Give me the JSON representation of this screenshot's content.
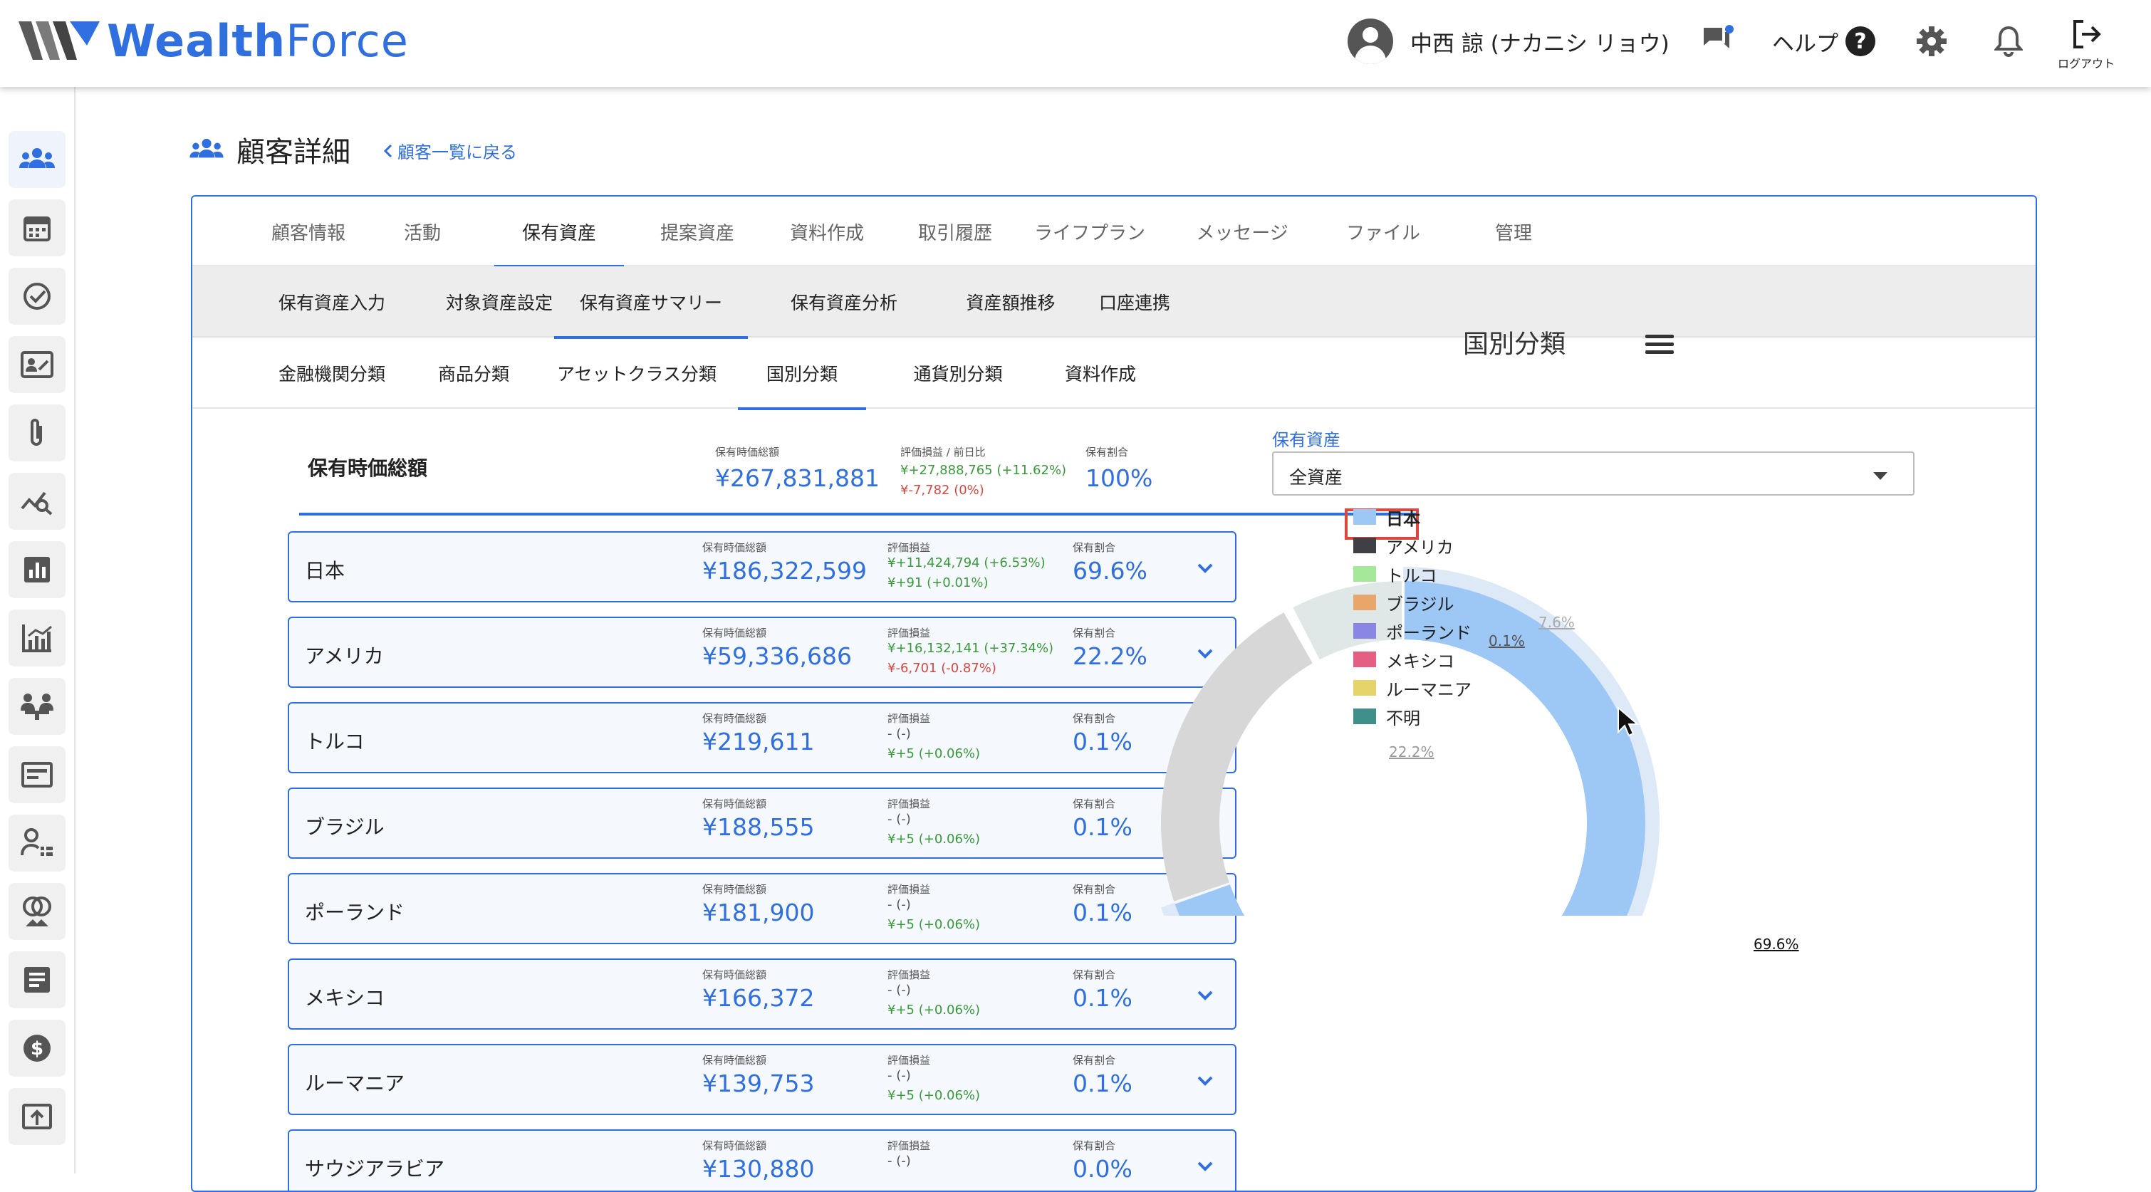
{
  "app": {
    "brand_strong": "Wealth",
    "brand_rest": "Force",
    "user_name": "中西 諒 (ナカニシ リョウ)",
    "help_label": "ヘルプ",
    "help_mark": "?",
    "logout_label": "ログアウト"
  },
  "page": {
    "title": "顧客詳細",
    "back_link": "顧客一覧に戻る"
  },
  "tabs_main": [
    "顧客情報",
    "活動",
    "保有資産",
    "提案資産",
    "資料作成",
    "取引履歴",
    "ライフプラン",
    "メッセージ",
    "ファイル",
    "管理"
  ],
  "tabs_main_active": "保有資産",
  "tabs_sub": [
    "保有資産入力",
    "対象資産設定",
    "保有資産サマリー",
    "保有資産分析",
    "資産額推移",
    "口座連携"
  ],
  "tabs_sub_active": "保有資産サマリー",
  "tabs_view": [
    "金融機関分類",
    "商品分類",
    "アセットクラス分類",
    "国別分類",
    "通貨別分類",
    "資料作成"
  ],
  "tabs_view_active": "国別分類",
  "summary": {
    "name": "保有時価総額",
    "value_label": "保有時価総額",
    "value": "¥267,831,881",
    "pl_label": "評価損益 / 前日比",
    "pl_total": "¥+27,888,765 (+11.62%)",
    "pl_day": "¥-7,782 (0%)",
    "share_label": "保有割合",
    "share": "100%"
  },
  "rows": [
    {
      "name": "日本",
      "value_label": "保有時価総額",
      "value": "¥186,322,599",
      "pl_label": "評価損益",
      "pl_total": "¥+11,424,794 (+6.53%)",
      "pl_day": "¥+91 (+0.01%)",
      "share_label": "保有割合",
      "share": "69.6%"
    },
    {
      "name": "アメリカ",
      "value_label": "保有時価総額",
      "value": "¥59,336,686",
      "pl_label": "評価損益",
      "pl_total": "¥+16,132,141 (+37.34%)",
      "pl_day": "¥-6,701 (-0.87%)",
      "share_label": "保有割合",
      "share": "22.2%"
    },
    {
      "name": "トルコ",
      "value_label": "保有時価総額",
      "value": "¥219,611",
      "pl_label": "評価損益",
      "pl_total": "- (-)",
      "pl_day": "¥+5 (+0.06%)",
      "share_label": "保有割合",
      "share": "0.1%"
    },
    {
      "name": "ブラジル",
      "value_label": "保有時価総額",
      "value": "¥188,555",
      "pl_label": "評価損益",
      "pl_total": "- (-)",
      "pl_day": "¥+5 (+0.06%)",
      "share_label": "保有割合",
      "share": "0.1%"
    },
    {
      "name": "ポーランド",
      "value_label": "保有時価総額",
      "value": "¥181,900",
      "pl_label": "評価損益",
      "pl_total": "- (-)",
      "pl_day": "¥+5 (+0.06%)",
      "share_label": "保有割合",
      "share": "0.1%"
    },
    {
      "name": "メキシコ",
      "value_label": "保有時価総額",
      "value": "¥166,372",
      "pl_label": "評価損益",
      "pl_total": "- (-)",
      "pl_day": "¥+5 (+0.06%)",
      "share_label": "保有割合",
      "share": "0.1%"
    },
    {
      "name": "ルーマニア",
      "value_label": "保有時価総額",
      "value": "¥139,753",
      "pl_label": "評価損益",
      "pl_total": "- (-)",
      "pl_day": "¥+5 (+0.06%)",
      "share_label": "保有割合",
      "share": "0.1%"
    },
    {
      "name": "サウジアラビア",
      "value_label": "保有時価総額",
      "value": "¥130,880",
      "pl_label": "評価損益",
      "pl_total": "- (-)",
      "pl_day": "",
      "share_label": "保有割合",
      "share": "0.0%"
    }
  ],
  "filter": {
    "label": "保有資産",
    "selected": "全資産"
  },
  "chart_data": {
    "type": "pie",
    "title": "国別分類",
    "categories": [
      "日本",
      "アメリカ",
      "トルコ",
      "ブラジル",
      "ポーランド",
      "メキシコ",
      "ルーマニア",
      "不明"
    ],
    "colors": [
      "#9dc7f5",
      "#3f3f46",
      "#a6e89a",
      "#e9a66b",
      "#8a86e6",
      "#e45f82",
      "#e5d46a",
      "#3f8f8a"
    ],
    "values": [
      69.6,
      22.2,
      0.1,
      0.1,
      0.1,
      0.1,
      0.1,
      7.6
    ],
    "slice_labels": [
      "69.6%",
      "22.2%",
      "0.1%",
      "7.6%"
    ],
    "legend_position": "center",
    "highlighted_legend_item": "日本",
    "hover_slice": "日本"
  }
}
